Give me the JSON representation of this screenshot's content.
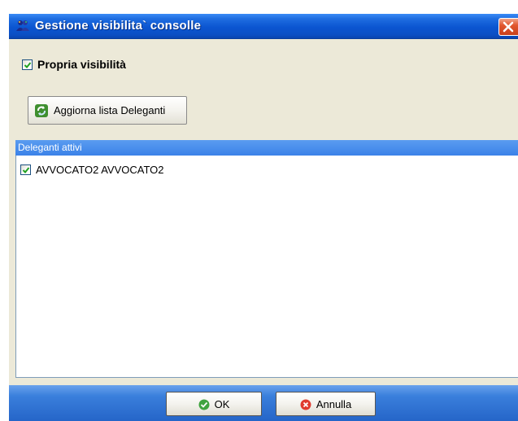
{
  "window": {
    "title": "Gestione visibilita` consolle",
    "title_icon": "people-icon",
    "close_icon": "close-icon"
  },
  "own_visibility": {
    "label": "Propria visibilità",
    "checked": true
  },
  "refresh_button": {
    "label": "Aggiorna lista Deleganti",
    "icon": "refresh-icon"
  },
  "delegates_list": {
    "header": "Deleganti attivi",
    "items": [
      {
        "label": "AVVOCATO2 AVVOCATO2",
        "checked": true
      }
    ]
  },
  "footer": {
    "ok_label": "OK",
    "ok_icon": "check-icon",
    "cancel_label": "Annulla",
    "cancel_icon": "cancel-icon"
  },
  "colors": {
    "titlebar": "#0b55d1",
    "list_header": "#3b82e8",
    "window_bg": "#ece9d8",
    "close_button": "#e2572f"
  }
}
